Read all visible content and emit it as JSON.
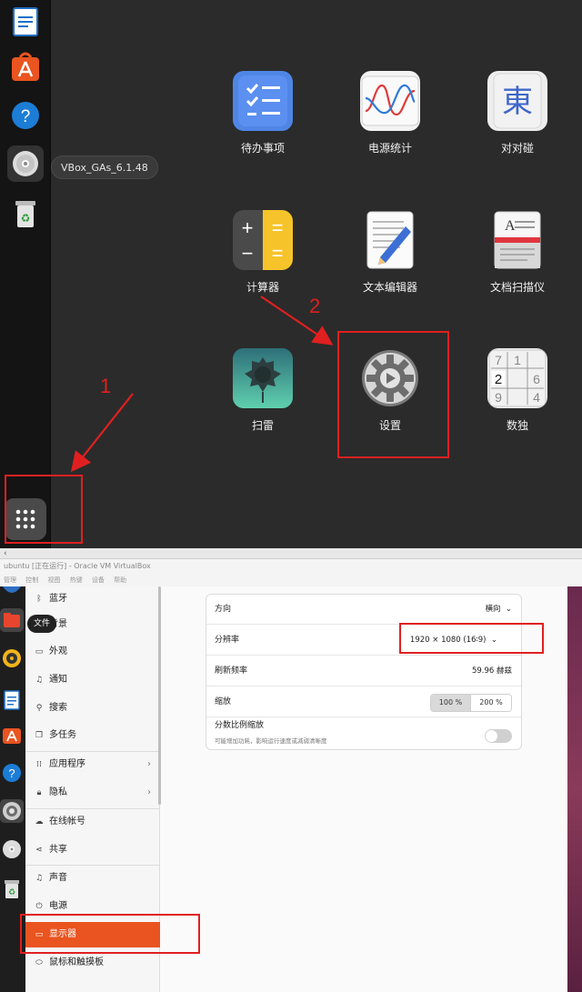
{
  "top": {
    "tooltip": "VBox_GAs_6.1.48",
    "apps": [
      {
        "label": "待办事项",
        "icon": "todo-icon"
      },
      {
        "label": "电源统计",
        "icon": "power-stats-icon"
      },
      {
        "label": "对对碰",
        "icon": "mahjongg-icon"
      },
      {
        "label": "计算器",
        "icon": "calculator-icon"
      },
      {
        "label": "文本编辑器",
        "icon": "text-editor-icon"
      },
      {
        "label": "文档扫描仪",
        "icon": "document-scanner-icon"
      },
      {
        "label": "扫雷",
        "icon": "mines-icon"
      },
      {
        "label": "设置",
        "icon": "settings-gear-icon"
      },
      {
        "label": "数独",
        "icon": "sudoku-icon"
      }
    ],
    "annotations": {
      "one": "1",
      "two": "2"
    },
    "sudoku_digits": [
      "7",
      "1",
      "2",
      "6",
      "9",
      "4"
    ],
    "calc_symbols": [
      "+",
      "=",
      "−",
      "="
    ],
    "mahjong_char": "東",
    "scanner_letter": "A"
  },
  "vbox": {
    "title": "ubuntu [正在运行] - Oracle VM VirtualBox",
    "menu": [
      "管理",
      "控制",
      "视图",
      "热键",
      "设备",
      "帮助"
    ],
    "file_tooltip": "文件",
    "sidebar": [
      {
        "label": "蓝牙",
        "icon": "bluetooth-icon"
      },
      {
        "label": "背景",
        "icon": "background-icon"
      },
      {
        "label": "外观",
        "icon": "appearance-icon"
      },
      {
        "label": "通知",
        "icon": "bell-icon"
      },
      {
        "label": "搜索",
        "icon": "search-icon"
      },
      {
        "label": "多任务",
        "icon": "multitask-icon"
      },
      {
        "label": "应用程序",
        "icon": "apps-icon",
        "chevron": "›"
      },
      {
        "label": "隐私",
        "icon": "lock-icon",
        "chevron": "›"
      },
      {
        "label": "在线帐号",
        "icon": "cloud-icon"
      },
      {
        "label": "共享",
        "icon": "share-icon"
      },
      {
        "label": "声音",
        "icon": "music-note-icon"
      },
      {
        "label": "电源",
        "icon": "power-icon"
      },
      {
        "label": "显示器",
        "icon": "display-icon"
      },
      {
        "label": "鼠标和触摸板",
        "icon": "mouse-icon"
      }
    ],
    "display": {
      "orientation_label": "方向",
      "orientation_value": "横向",
      "resolution_label": "分辨率",
      "resolution_value": "1920 × 1080 (16∶9)",
      "refresh_label": "刷新频率",
      "refresh_value": "59.96 赫兹",
      "scale_label": "缩放",
      "scale_options": [
        "100 %",
        "200 %"
      ],
      "fractional_label": "分数比例缩放",
      "fractional_sub": "可能增加功耗，影响运行速度或减弱清晰度",
      "chevron": "⌄"
    }
  }
}
